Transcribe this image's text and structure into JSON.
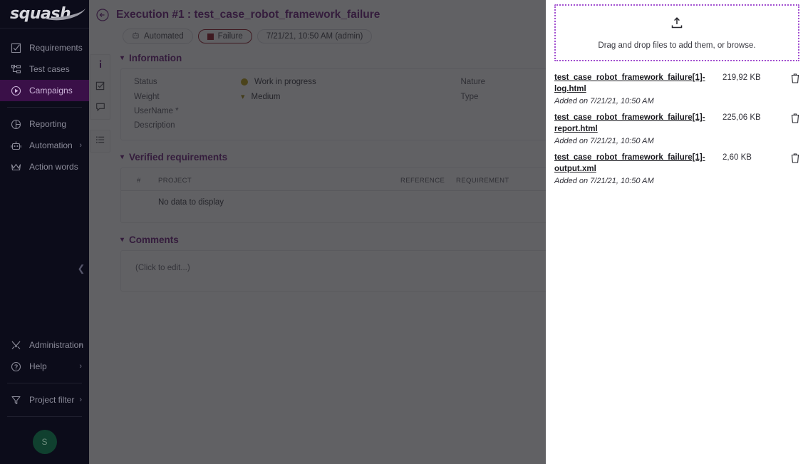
{
  "app": {
    "logo_text": "squash"
  },
  "sidebar": {
    "items": [
      {
        "label": "Requirements",
        "icon": "requirements-icon",
        "active": false,
        "expandable": false
      },
      {
        "label": "Test cases",
        "icon": "test-cases-icon",
        "active": false,
        "expandable": false
      },
      {
        "label": "Campaigns",
        "icon": "campaigns-icon",
        "active": true,
        "expandable": false
      },
      {
        "label": "Reporting",
        "icon": "reporting-icon",
        "active": false,
        "expandable": false
      },
      {
        "label": "Automation",
        "icon": "automation-robot-icon",
        "active": false,
        "expandable": true
      },
      {
        "label": "Action words",
        "icon": "action-words-crown-icon",
        "active": false,
        "expandable": false
      }
    ],
    "bottom_items": [
      {
        "label": "Administration",
        "icon": "administration-icon",
        "expandable": true
      },
      {
        "label": "Help",
        "icon": "help-question-icon",
        "expandable": true
      },
      {
        "label": "Project filter",
        "icon": "filter-funnel-icon",
        "expandable": true
      }
    ],
    "avatar_initial": "S",
    "collapse_icon": "chevron-left-icon",
    "active_color": "#3a1048",
    "background_color": "#0c0c1a"
  },
  "header": {
    "back_icon": "back-arrow-circle-icon",
    "title": "Execution #1 : test_case_robot_framework_failure",
    "title_color": "#6a1a7a",
    "chips": [
      {
        "label": "Automated",
        "icon": "robot-icon",
        "type": "plain"
      },
      {
        "label": "Failure",
        "icon": "status-square-icon",
        "type": "failure",
        "color": "#8e1320"
      },
      {
        "label": "7/21/21, 10:50 AM (admin)",
        "icon": "",
        "type": "plain"
      }
    ]
  },
  "rail": {
    "buttons": [
      {
        "name": "information-tab",
        "icon": "info-icon",
        "active": true
      },
      {
        "name": "execution-steps-tab",
        "icon": "checkbox-edit-icon",
        "active": false
      },
      {
        "name": "comments-tab",
        "icon": "comment-bubble-icon",
        "active": false
      },
      {
        "name": "list-tab",
        "icon": "list-icon",
        "active": false
      }
    ]
  },
  "information": {
    "title": "Information",
    "fields": [
      {
        "label": "Status",
        "value": "Work in progress",
        "icon": "status-dot-icon",
        "color": "#b59a0b"
      },
      {
        "label": "Nature",
        "value": ""
      },
      {
        "label": "Weight",
        "value": "Medium",
        "icon": "weight-chevron-icon",
        "color": "#9a8408"
      },
      {
        "label": "Type",
        "value": ""
      },
      {
        "label": "UserName *",
        "value": ""
      },
      {
        "label": "Description",
        "value": ""
      }
    ]
  },
  "verified_requirements": {
    "title": "Verified requirements",
    "columns": [
      "#",
      "PROJECT",
      "REFERENCE",
      "REQUIREMENT"
    ],
    "empty_message": "No data to display"
  },
  "comments": {
    "title": "Comments",
    "placeholder": "(Click to edit...)"
  },
  "attachments": {
    "dropzone_text": "Drag and drop files to add them, or browse.",
    "dropzone_icon": "upload-icon",
    "border_color": "#a24fd0",
    "files": [
      {
        "name": "test_case_robot_framework_failure[1]-log.html",
        "size": "219,92 KB",
        "added": "Added on 7/21/21, 10:50 AM",
        "delete_icon": "trash-icon"
      },
      {
        "name": "test_case_robot_framework_failure[1]-report.html",
        "size": "225,06 KB",
        "added": "Added on 7/21/21, 10:50 AM",
        "delete_icon": "trash-icon"
      },
      {
        "name": "test_case_robot_framework_failure[1]-output.xml",
        "size": "2,60 KB",
        "added": "Added on 7/21/21, 10:50 AM",
        "delete_icon": "trash-icon"
      }
    ]
  }
}
